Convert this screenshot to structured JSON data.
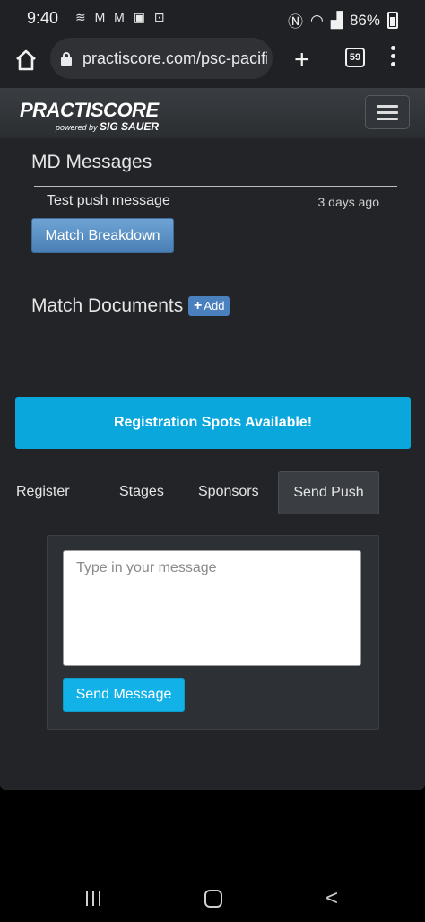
{
  "status_bar": {
    "time": "9:40",
    "left_icons": [
      "mail-outline-icon",
      "gmail-icon",
      "gmail-icon",
      "image-icon",
      "screenshot-icon"
    ],
    "battery": "86%"
  },
  "browser": {
    "url": "practiscore.com/psc-pacific",
    "tab_count": "59"
  },
  "site": {
    "logo": "PRACTISCORE",
    "logo_sub": "powered by",
    "logo_brand": "SIG SAUER"
  },
  "md_messages": {
    "title": "MD Messages",
    "items": [
      {
        "text": "Test push message",
        "time": "3 days ago"
      }
    ]
  },
  "match_breakdown_label": "Match Breakdown",
  "documents": {
    "title": "Match Documents",
    "add_label": "Add"
  },
  "registration_banner": "Registration Spots Available!",
  "tabs": [
    {
      "label": "Register"
    },
    {
      "label": "Stages"
    },
    {
      "label": "Sponsors"
    },
    {
      "label": "Send Push",
      "active": true
    }
  ],
  "push_form": {
    "placeholder": "Type in your message",
    "value": "",
    "send_label": "Send Message"
  },
  "colors": {
    "banner": "#0aa7dc",
    "match_button": "#5b8fc6",
    "send_button": "#12b2e8",
    "background": "#222427"
  }
}
